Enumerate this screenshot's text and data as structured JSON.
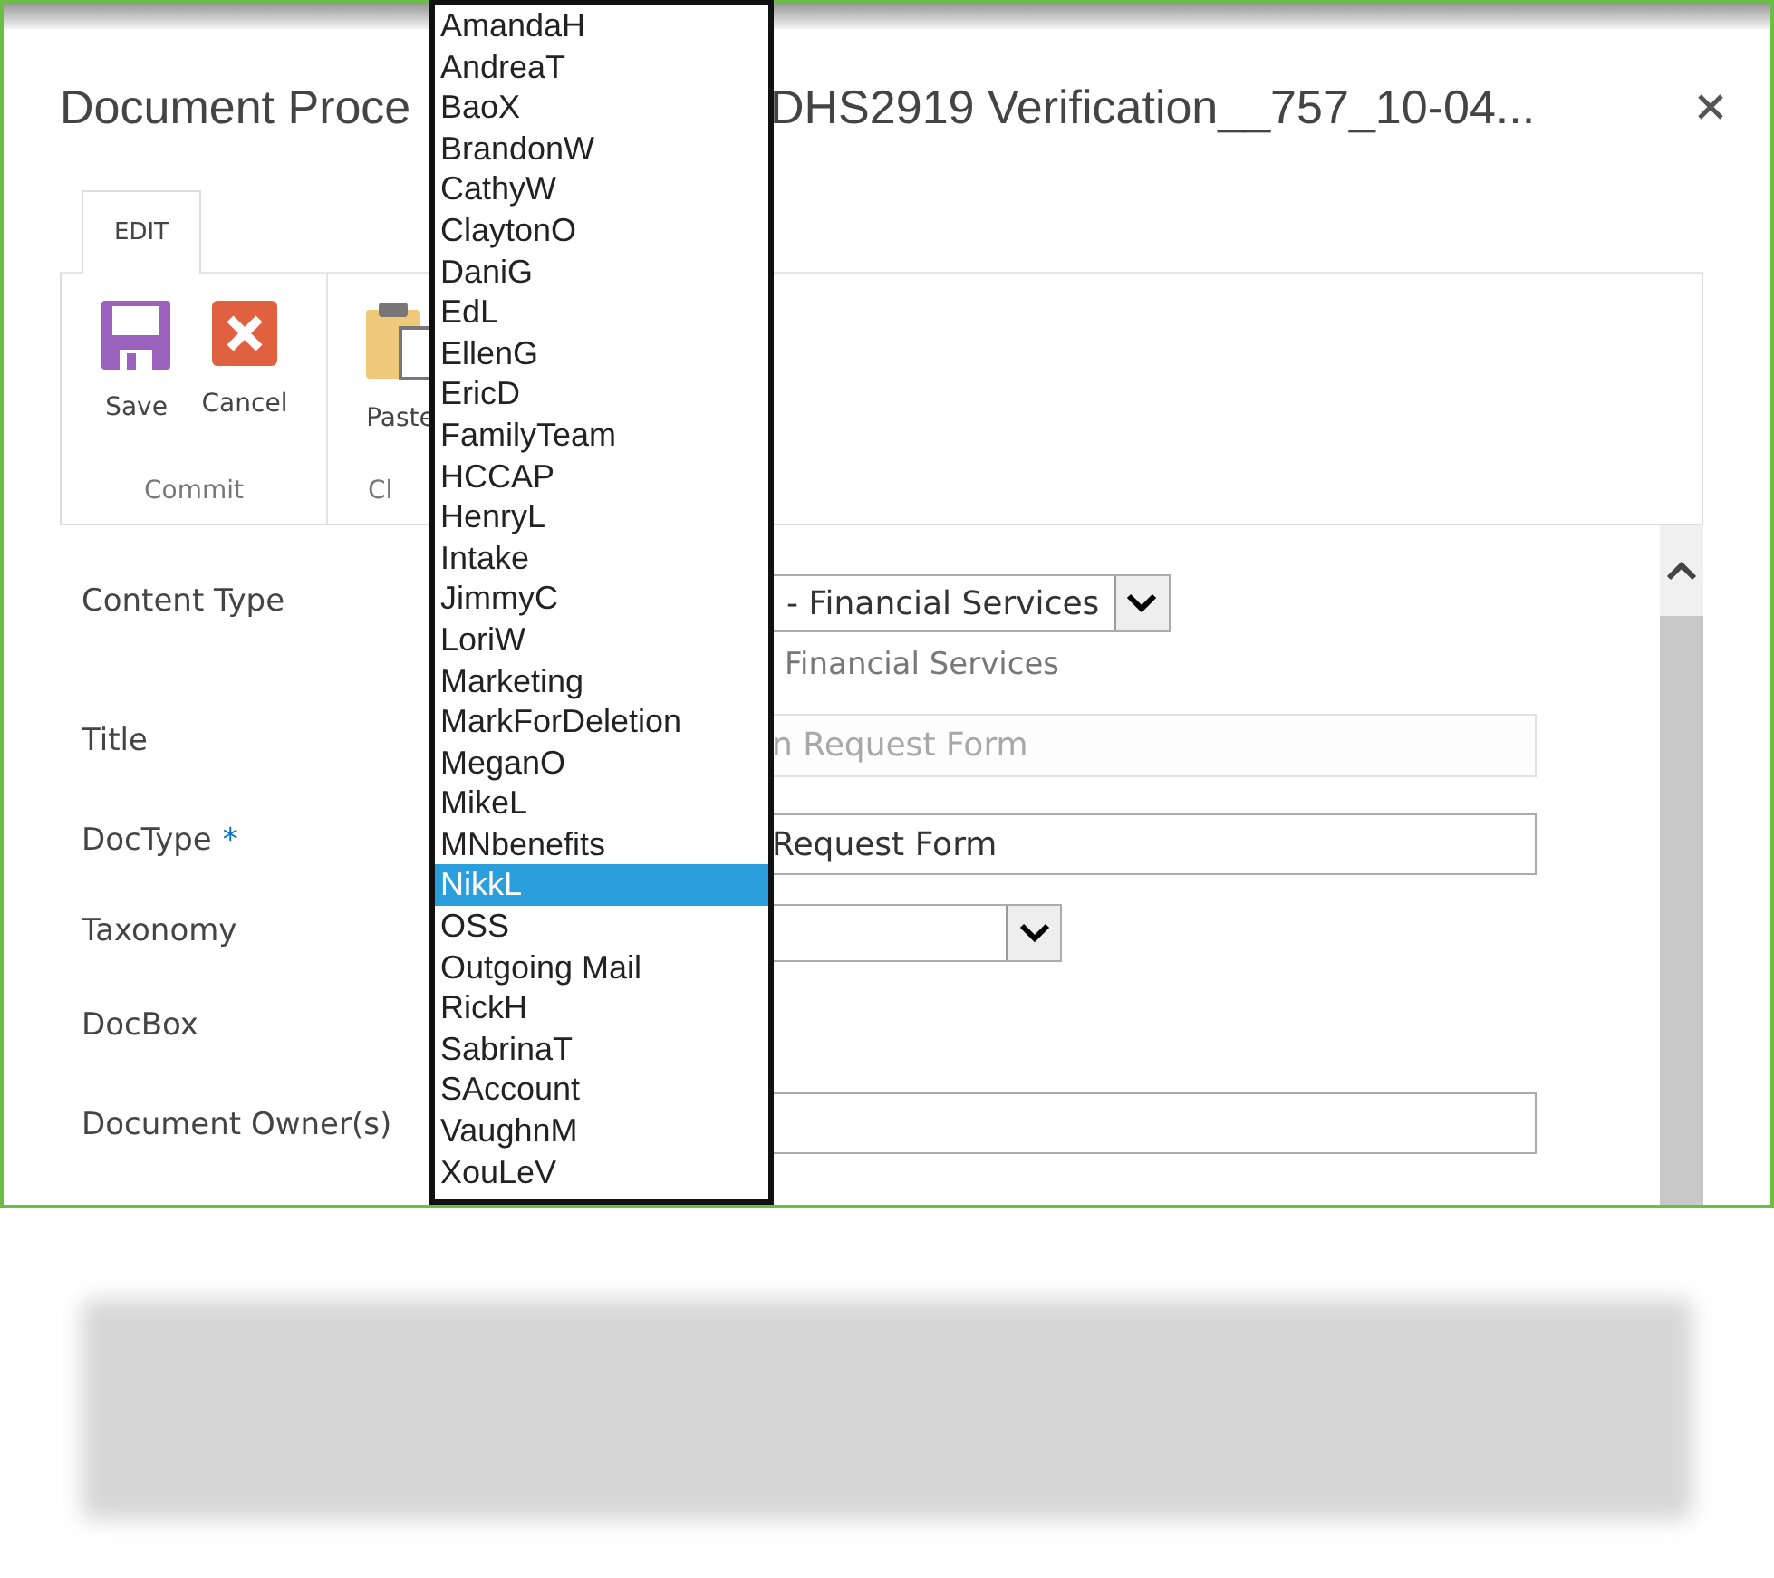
{
  "dialog": {
    "title_start": "Document Proce",
    "title_end": "DHS2919 Verification__757_10-04..."
  },
  "ribbon": {
    "tabs": [
      {
        "label": "EDIT",
        "selected": true
      }
    ],
    "groups": [
      {
        "label": "Commit",
        "buttons": [
          {
            "kind": "save",
            "label": "Save"
          },
          {
            "kind": "cancel",
            "label": "Cancel"
          }
        ]
      },
      {
        "label": "Cl",
        "buttons": [
          {
            "kind": "paste",
            "label": "Paste"
          }
        ]
      }
    ]
  },
  "form": {
    "fields": [
      {
        "label": "Content Type",
        "kind": "select",
        "value": "- Financial Services",
        "hint": "Financial Services"
      },
      {
        "label": "Title",
        "kind": "text",
        "disabled": true,
        "value": "n Request Form"
      },
      {
        "label": "DocType",
        "kind": "text",
        "disabled": false,
        "value": "Request Form",
        "required_mark": "*"
      },
      {
        "label": "Taxonomy",
        "kind": "select"
      },
      {
        "label": "DocBox",
        "kind": "empty"
      },
      {
        "label": "Document Owner(s)",
        "kind": "text",
        "disabled": false
      }
    ]
  },
  "dropdown": {
    "options": [
      {
        "label": "AmandaH",
        "selected": false
      },
      {
        "label": "AndreaT",
        "selected": false
      },
      {
        "label": "BaoX",
        "selected": false
      },
      {
        "label": "BrandonW",
        "selected": false
      },
      {
        "label": "CathyW",
        "selected": false
      },
      {
        "label": "ClaytonO",
        "selected": false
      },
      {
        "label": "DaniG",
        "selected": false
      },
      {
        "label": "EdL",
        "selected": false
      },
      {
        "label": "EllenG",
        "selected": false
      },
      {
        "label": "EricD",
        "selected": false
      },
      {
        "label": "FamilyTeam",
        "selected": false
      },
      {
        "label": "HCCAP",
        "selected": false
      },
      {
        "label": "HenryL",
        "selected": false
      },
      {
        "label": "Intake",
        "selected": false
      },
      {
        "label": "JimmyC",
        "selected": false
      },
      {
        "label": "LoriW",
        "selected": false
      },
      {
        "label": "Marketing",
        "selected": false
      },
      {
        "label": "MarkForDeletion",
        "selected": false
      },
      {
        "label": "MeganO",
        "selected": false
      },
      {
        "label": "MikeL",
        "selected": false
      },
      {
        "label": "MNbenefits",
        "selected": false
      },
      {
        "label": "NikkL",
        "selected": true
      },
      {
        "label": "OSS",
        "selected": false
      },
      {
        "label": "Outgoing Mail",
        "selected": false
      },
      {
        "label": "RickH",
        "selected": false
      },
      {
        "label": "SabrinaT",
        "selected": false
      },
      {
        "label": "SAccount",
        "selected": false
      },
      {
        "label": "VaughnM",
        "selected": false
      },
      {
        "label": "XouLeV",
        "selected": false
      }
    ]
  }
}
